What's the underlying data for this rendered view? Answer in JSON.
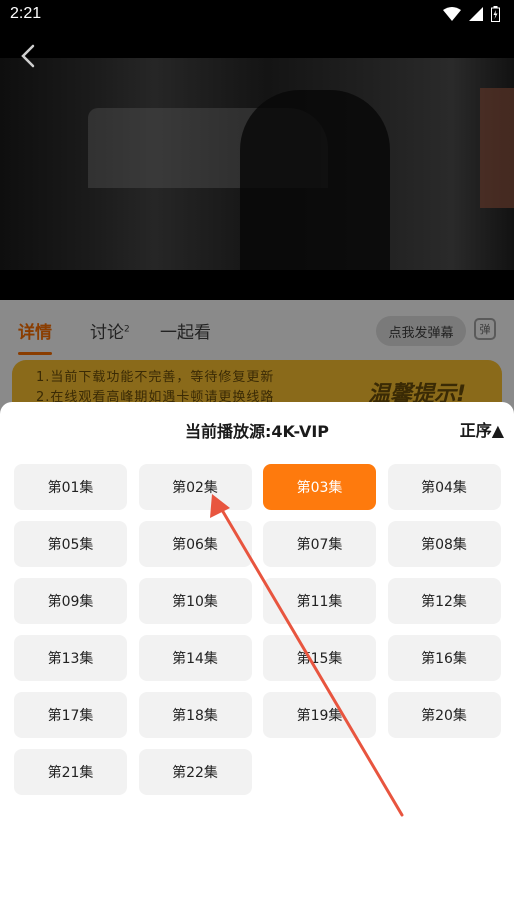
{
  "status_bar": {
    "time": "2:21"
  },
  "tabs": [
    {
      "label": "详情"
    },
    {
      "label": "讨论",
      "badge": "2"
    },
    {
      "label": "一起看"
    }
  ],
  "danmu": {
    "button_label": "点我发弹幕",
    "icon_label": "弹"
  },
  "notice": {
    "line1": "1.当前下载功能不完善，等待修复更新",
    "line2": "2.在线观看高峰期如遇卡顿请更换线路",
    "title": "温馨提示!"
  },
  "sheet": {
    "title": "当前播放源:4K-VIP",
    "order_label": "正序▲"
  },
  "episodes": [
    "第01集",
    "第02集",
    "第03集",
    "第04集",
    "第05集",
    "第06集",
    "第07集",
    "第08集",
    "第09集",
    "第10集",
    "第11集",
    "第12集",
    "第13集",
    "第14集",
    "第15集",
    "第16集",
    "第17集",
    "第18集",
    "第19集",
    "第20集",
    "第21集",
    "第22集"
  ],
  "current_episode": "第03集",
  "colors": {
    "accent": "#fe7a0d",
    "annotation_arrow": "#e8553f"
  }
}
